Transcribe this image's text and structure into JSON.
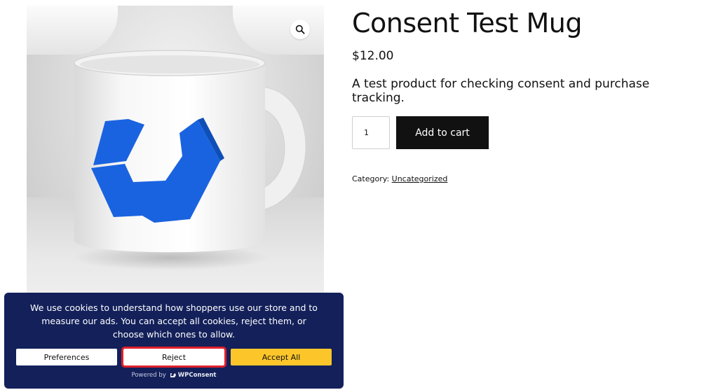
{
  "product": {
    "title": "Consent Test Mug",
    "price": "$12.00",
    "description": "A test product for checking consent and purchase tracking.",
    "quantity": "1",
    "add_to_cart_label": "Add to cart",
    "category_label": "Category:",
    "category_value": "Uncategorized"
  },
  "image": {
    "zoom_icon": "magnifier-icon",
    "logo_color": "#1a63e0"
  },
  "consent": {
    "text": "We use cookies to understand how shoppers use our store and to measure our ads. You can accept all cookies, reject them, or choose which ones to allow.",
    "preferences_label": "Preferences",
    "reject_label": "Reject",
    "accept_label": "Accept All",
    "powered_by": "Powered by",
    "brand": "WPConsent",
    "background_color": "#13205a",
    "accept_color": "#fcc62b",
    "highlight_color": "#e0202a"
  }
}
